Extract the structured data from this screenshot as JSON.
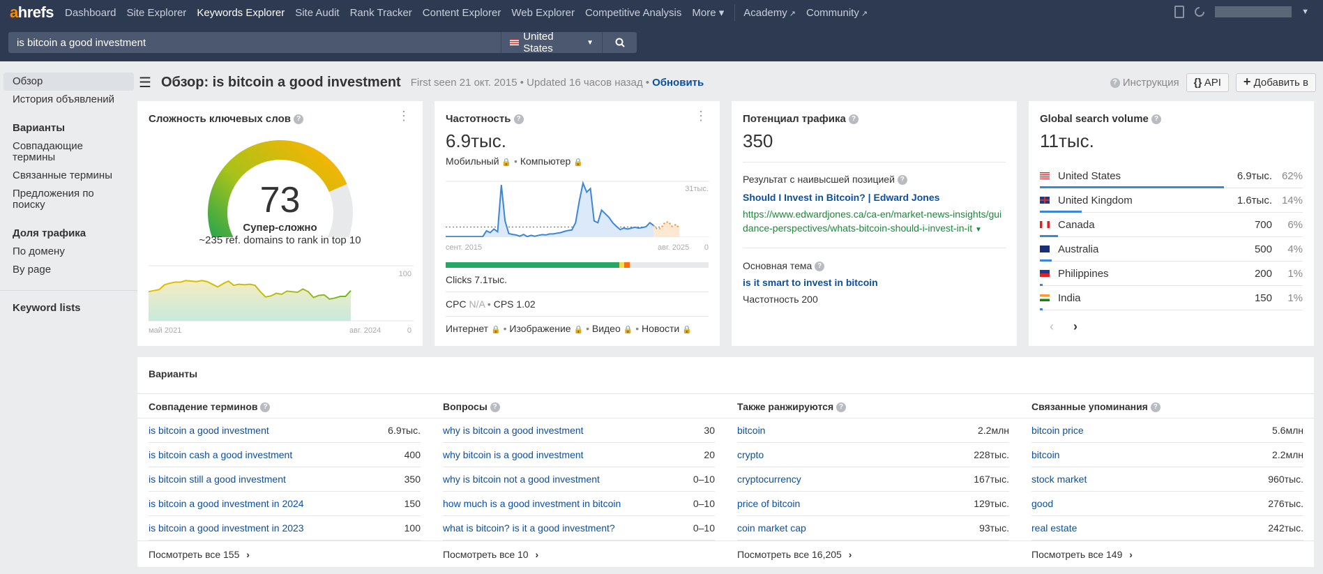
{
  "nav": {
    "logo_a": "a",
    "logo_rest": "hrefs",
    "items": [
      "Dashboard",
      "Site Explorer",
      "Keywords Explorer",
      "Site Audit",
      "Rank Tracker",
      "Content Explorer",
      "Web Explorer",
      "Competitive Analysis",
      "More ▾"
    ],
    "active": "Keywords Explorer",
    "ext_items": [
      "Academy",
      "Community"
    ]
  },
  "search": {
    "query": "is bitcoin a good investment",
    "country": "United States"
  },
  "sidebar": {
    "items": [
      "Обзор",
      "История объявлений"
    ],
    "variants_head": "Варианты",
    "variants": [
      "Совпадающие термины",
      "Связанные термины",
      "Предложения по поиску"
    ],
    "traffic_head": "Доля трафика",
    "traffic": [
      "По домену",
      "By page"
    ],
    "lists": "Keyword lists"
  },
  "header": {
    "title": "Обзор: is bitcoin a good investment",
    "first_seen": "First seen 21 окт. 2015",
    "updated": "Updated 16 часов назад",
    "refresh": "Обновить",
    "guide": "Инструкция",
    "api": "API",
    "add": "Добавить в"
  },
  "kd": {
    "title": "Сложность ключевых слов",
    "value": "73",
    "score": 73,
    "label": "Супер-сложно",
    "sub": "~235 ref. domains to rank in top 10",
    "y_max": "100",
    "y_min": "0",
    "x_start": "май 2021",
    "x_end": "авг. 2024",
    "history": [
      55,
      57,
      59,
      68,
      71,
      73,
      73,
      76,
      75,
      74,
      76,
      74,
      69,
      64,
      70,
      75,
      67,
      69,
      68,
      69,
      67,
      55,
      45,
      47,
      52,
      50,
      56,
      55,
      54,
      60,
      55,
      44,
      48,
      49,
      41,
      43,
      46,
      46,
      57
    ]
  },
  "volume": {
    "title": "Частотность",
    "value": "6.9тыс.",
    "mobile": "Мобильный",
    "desktop": "Компьютер",
    "y_max": "31тыс.",
    "y_min": "0",
    "x_start": "сент. 2015",
    "x_end": "авг. 2025",
    "history": [
      0.3,
      0.3,
      0.3,
      0.3,
      0.3,
      0.3,
      0.3,
      0.3,
      0.3,
      0.3,
      0.3,
      3.5,
      2.5,
      4.5,
      3,
      29,
      9,
      2,
      1.5,
      1.2,
      0.5,
      1.5,
      0.3,
      1,
      0.5,
      1,
      1.4,
      1.2,
      1.8,
      1.8,
      2.2,
      2.5,
      3.2,
      3.7,
      4,
      8,
      20,
      30,
      25,
      27,
      9,
      8,
      15,
      13,
      11,
      8,
      6,
      4.2,
      5,
      4.5,
      5,
      5.5,
      5,
      5.3,
      5.8,
      8,
      6.5
    ],
    "forecast": [
      4.5,
      5,
      8,
      8.5,
      6,
      7,
      5
    ],
    "clicks": "Clicks 7.1тыс.",
    "clicks_split": [
      66,
      2,
      2
    ],
    "cpc_label": "CPC",
    "cpc": "N/A",
    "cps": "CPS 1.02",
    "serp": [
      "Интернет",
      "Изображение",
      "Видео",
      "Новости"
    ]
  },
  "tp": {
    "title": "Потенциал трафика",
    "value": "350",
    "top_label": "Результат с наивысшей позицией",
    "top_title": "Should I Invest in Bitcoin? | Edward Jones",
    "top_url": "https://www.edwardjones.ca/ca-en/market-news-insights/guidance-perspectives/whats-bitcoin-should-i-invest-in-it",
    "topic_label": "Основная тема",
    "topic": "is it smart to invest in bitcoin",
    "topic_vol": "Частотность 200"
  },
  "gsv": {
    "title": "Global search volume",
    "value": "11тыс.",
    "rows": [
      {
        "country": "United States",
        "vol": "6.9тыс.",
        "pct": "62%",
        "share": 62,
        "flag": "us"
      },
      {
        "country": "United Kingdom",
        "vol": "1.6тыс.",
        "pct": "14%",
        "share": 14,
        "flag": "gb"
      },
      {
        "country": "Canada",
        "vol": "700",
        "pct": "6%",
        "share": 6,
        "flag": "ca"
      },
      {
        "country": "Australia",
        "vol": "500",
        "pct": "4%",
        "share": 4,
        "flag": "au"
      },
      {
        "country": "Philippines",
        "vol": "200",
        "pct": "1%",
        "share": 1,
        "flag": "ph"
      },
      {
        "country": "India",
        "vol": "150",
        "pct": "1%",
        "share": 1,
        "flag": "in"
      }
    ]
  },
  "variants": {
    "title": "Варианты",
    "cols": [
      {
        "head": "Совпадение терминов",
        "rows": [
          [
            "is bitcoin a good investment",
            "6.9тыс."
          ],
          [
            "is bitcoin cash a good investment",
            "400"
          ],
          [
            "is bitcoin still a good investment",
            "350"
          ],
          [
            "is bitcoin a good investment in 2024",
            "150"
          ],
          [
            "is bitcoin a good investment in 2023",
            "100"
          ]
        ],
        "more": "Посмотреть все 155"
      },
      {
        "head": "Вопросы",
        "rows": [
          [
            "why is bitcoin a good investment",
            "30"
          ],
          [
            "why bitcoin is a good investment",
            "20"
          ],
          [
            "why is bitcoin not a good investment",
            "0–10"
          ],
          [
            "how much is a good investment in bitcoin",
            "0–10"
          ],
          [
            "what is bitcoin? is it a good investment?",
            "0–10"
          ]
        ],
        "more": "Посмотреть все 10"
      },
      {
        "head": "Также ранжируются",
        "rows": [
          [
            "bitcoin",
            "2.2млн"
          ],
          [
            "crypto",
            "228тыс."
          ],
          [
            "cryptocurrency",
            "167тыс."
          ],
          [
            "price of bitcoin",
            "129тыс."
          ],
          [
            "coin market cap",
            "93тыс."
          ]
        ],
        "more": "Посмотреть все 16,205"
      },
      {
        "head": "Связанные упоминания",
        "rows": [
          [
            "bitcoin price",
            "5.6млн"
          ],
          [
            "bitcoin",
            "2.2млн"
          ],
          [
            "stock market",
            "960тыс."
          ],
          [
            "good",
            "276тыс."
          ],
          [
            "real estate",
            "242тыс."
          ]
        ],
        "more": "Посмотреть все 149"
      }
    ]
  }
}
